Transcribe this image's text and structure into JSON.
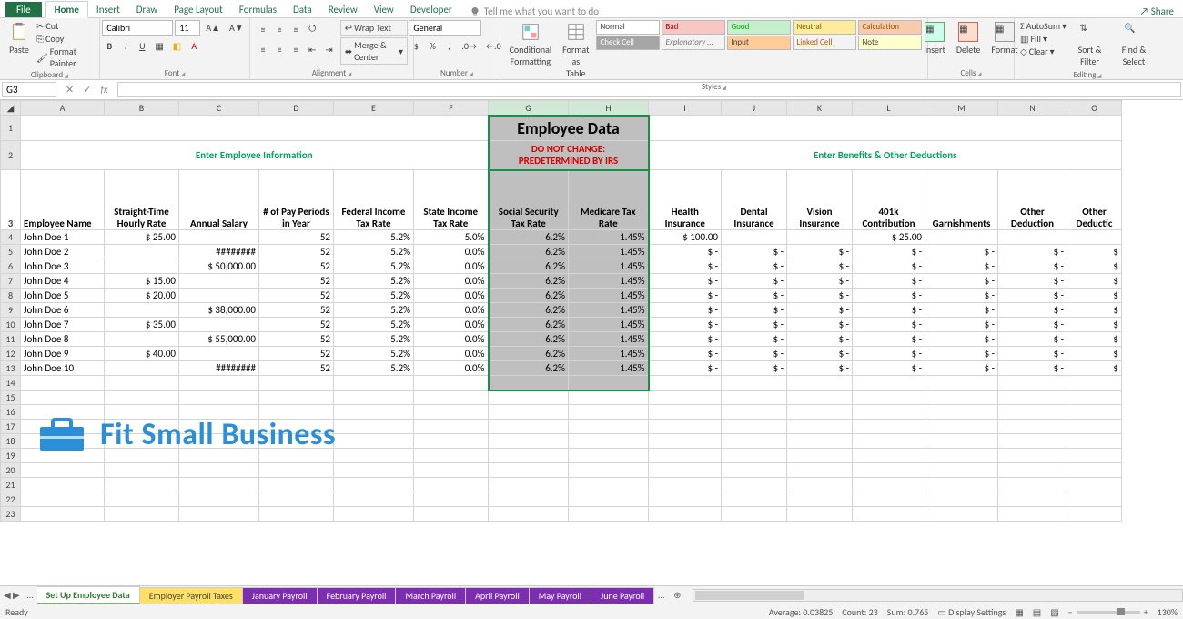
{
  "menu": {
    "file": "File",
    "home": "Home",
    "insert": "Insert",
    "draw": "Draw",
    "pagelayout": "Page Layout",
    "formulas": "Formulas",
    "data": "Data",
    "review": "Review",
    "view": "View",
    "developer": "Developer",
    "tellme": "Tell me what you want to do",
    "share": "Share"
  },
  "ribbon": {
    "clipboard": {
      "title": "Clipboard",
      "paste": "Paste",
      "cut": "Cut",
      "copy": "Copy",
      "fp": "Format Painter"
    },
    "font": {
      "title": "Font",
      "name": "Calibri",
      "size": "11"
    },
    "alignment": {
      "title": "Alignment",
      "wrap": "Wrap Text",
      "merge": "Merge & Center"
    },
    "number": {
      "title": "Number",
      "format": "General"
    },
    "styles": {
      "title": "Styles",
      "cond": "Conditional Formatting",
      "fat": "Format as Table",
      "gal": [
        "Normal",
        "Bad",
        "Good",
        "Neutral",
        "Calculation",
        "Check Cell",
        "Explanatory ...",
        "Input",
        "Linked Cell",
        "Note"
      ]
    },
    "cells": {
      "title": "Cells",
      "insert": "Insert",
      "delete": "Delete",
      "format": "Format"
    },
    "editing": {
      "title": "Editing",
      "autosum": "AutoSum",
      "fill": "Fill",
      "clear": "Clear",
      "sort": "Sort & Filter",
      "find": "Find & Select"
    }
  },
  "namebox": "G3",
  "columns": [
    "A",
    "B",
    "C",
    "D",
    "E",
    "F",
    "G",
    "H",
    "I",
    "J",
    "K",
    "L",
    "M",
    "N",
    "O"
  ],
  "row1": {
    "title": "Employee Data"
  },
  "row2": {
    "left": "Enter Employee Information",
    "mid1": "DO NOT CHANGE:",
    "mid2": "PREDETERMINED BY IRS",
    "right": "Enter Benefits & Other Deductions"
  },
  "headers": [
    "Employee  Name",
    "Straight-Time Hourly Rate",
    "Annual Salary",
    "# of Pay Periods in Year",
    "Federal Income Tax Rate",
    "State Income Tax Rate",
    "Social Security Tax Rate",
    "Medicare Tax Rate",
    "Health Insurance",
    "Dental Insurance",
    "Vision Insurance",
    "401k Contribution",
    "Garnishments",
    "Other Deduction",
    "Other Deductic"
  ],
  "rows": [
    {
      "n": 4,
      "a": "John Doe 1",
      "b": "$        25.00",
      "c": "",
      "d": "52",
      "e": "5.2%",
      "f": "5.0%",
      "g": "6.2%",
      "h": "1.45%",
      "i": "$    100.00",
      "j": "",
      "k": "",
      "l": "$        25.00",
      "m": "",
      "nv": "",
      "o": ""
    },
    {
      "n": 5,
      "a": "John Doe 2",
      "b": "",
      "c": "########",
      "d": "52",
      "e": "5.2%",
      "f": "0.0%",
      "g": "6.2%",
      "h": "1.45%",
      "i": "$          -",
      "j": "$          -",
      "k": "$          -",
      "l": "$          -",
      "m": "$          -",
      "nv": "$          -",
      "o": "$"
    },
    {
      "n": 6,
      "a": "John Doe 3",
      "b": "",
      "c": "$ 50,000.00",
      "d": "52",
      "e": "5.2%",
      "f": "0.0%",
      "g": "6.2%",
      "h": "1.45%",
      "i": "$          -",
      "j": "$          -",
      "k": "$          -",
      "l": "$          -",
      "m": "$          -",
      "nv": "$          -",
      "o": "$"
    },
    {
      "n": 7,
      "a": "John Doe 4",
      "b": "$        15.00",
      "c": "",
      "d": "52",
      "e": "5.2%",
      "f": "0.0%",
      "g": "6.2%",
      "h": "1.45%",
      "i": "$          -",
      "j": "$          -",
      "k": "$          -",
      "l": "$          -",
      "m": "$          -",
      "nv": "$          -",
      "o": "$"
    },
    {
      "n": 8,
      "a": "John Doe 5",
      "b": "$        20.00",
      "c": "",
      "d": "52",
      "e": "5.2%",
      "f": "0.0%",
      "g": "6.2%",
      "h": "1.45%",
      "i": "$          -",
      "j": "$          -",
      "k": "$          -",
      "l": "$          -",
      "m": "$          -",
      "nv": "$          -",
      "o": "$"
    },
    {
      "n": 9,
      "a": "John Doe 6",
      "b": "",
      "c": "$ 38,000.00",
      "d": "52",
      "e": "5.2%",
      "f": "0.0%",
      "g": "6.2%",
      "h": "1.45%",
      "i": "$          -",
      "j": "$          -",
      "k": "$          -",
      "l": "$          -",
      "m": "$          -",
      "nv": "$          -",
      "o": "$"
    },
    {
      "n": 10,
      "a": "John Doe 7",
      "b": "$        35.00",
      "c": "",
      "d": "52",
      "e": "5.2%",
      "f": "0.0%",
      "g": "6.2%",
      "h": "1.45%",
      "i": "$          -",
      "j": "$          -",
      "k": "$          -",
      "l": "$          -",
      "m": "$          -",
      "nv": "$          -",
      "o": "$"
    },
    {
      "n": 11,
      "a": "John Doe 8",
      "b": "",
      "c": "$ 55,000.00",
      "d": "52",
      "e": "5.2%",
      "f": "0.0%",
      "g": "6.2%",
      "h": "1.45%",
      "i": "$          -",
      "j": "$          -",
      "k": "$          -",
      "l": "$          -",
      "m": "$          -",
      "nv": "$          -",
      "o": "$"
    },
    {
      "n": 12,
      "a": "John Doe 9",
      "b": "$        40.00",
      "c": "",
      "d": "52",
      "e": "5.2%",
      "f": "0.0%",
      "g": "6.2%",
      "h": "1.45%",
      "i": "$          -",
      "j": "$          -",
      "k": "$          -",
      "l": "$          -",
      "m": "$          -",
      "nv": "$          -",
      "o": "$"
    },
    {
      "n": 13,
      "a": "John Doe 10",
      "b": "",
      "c": "########",
      "d": "52",
      "e": "5.2%",
      "f": "0.0%",
      "g": "6.2%",
      "h": "1.45%",
      "i": "$          -",
      "j": "$          -",
      "k": "$          -",
      "l": "$          -",
      "m": "$          -",
      "nv": "$          -",
      "o": "$"
    }
  ],
  "emptyrows": [
    14,
    15,
    16,
    17,
    18,
    19,
    20,
    21,
    22,
    23
  ],
  "watermark": "Fit Small Business",
  "sheets": {
    "nav": "…",
    "s1": "Set Up Employee Data",
    "s2": "Employer Payroll Taxes",
    "s3": "January Payroll",
    "s4": "February Payroll",
    "s5": "March Payroll",
    "s6": "April Payroll",
    "s7": "May Payroll",
    "s8": "June Payroll",
    "more": "…"
  },
  "status": {
    "ready": "Ready",
    "avg": "Average: 0.03825",
    "count": "Count: 23",
    "sum": "Sum: 0.765",
    "disp": "Display Settings",
    "zoom": "130%"
  }
}
